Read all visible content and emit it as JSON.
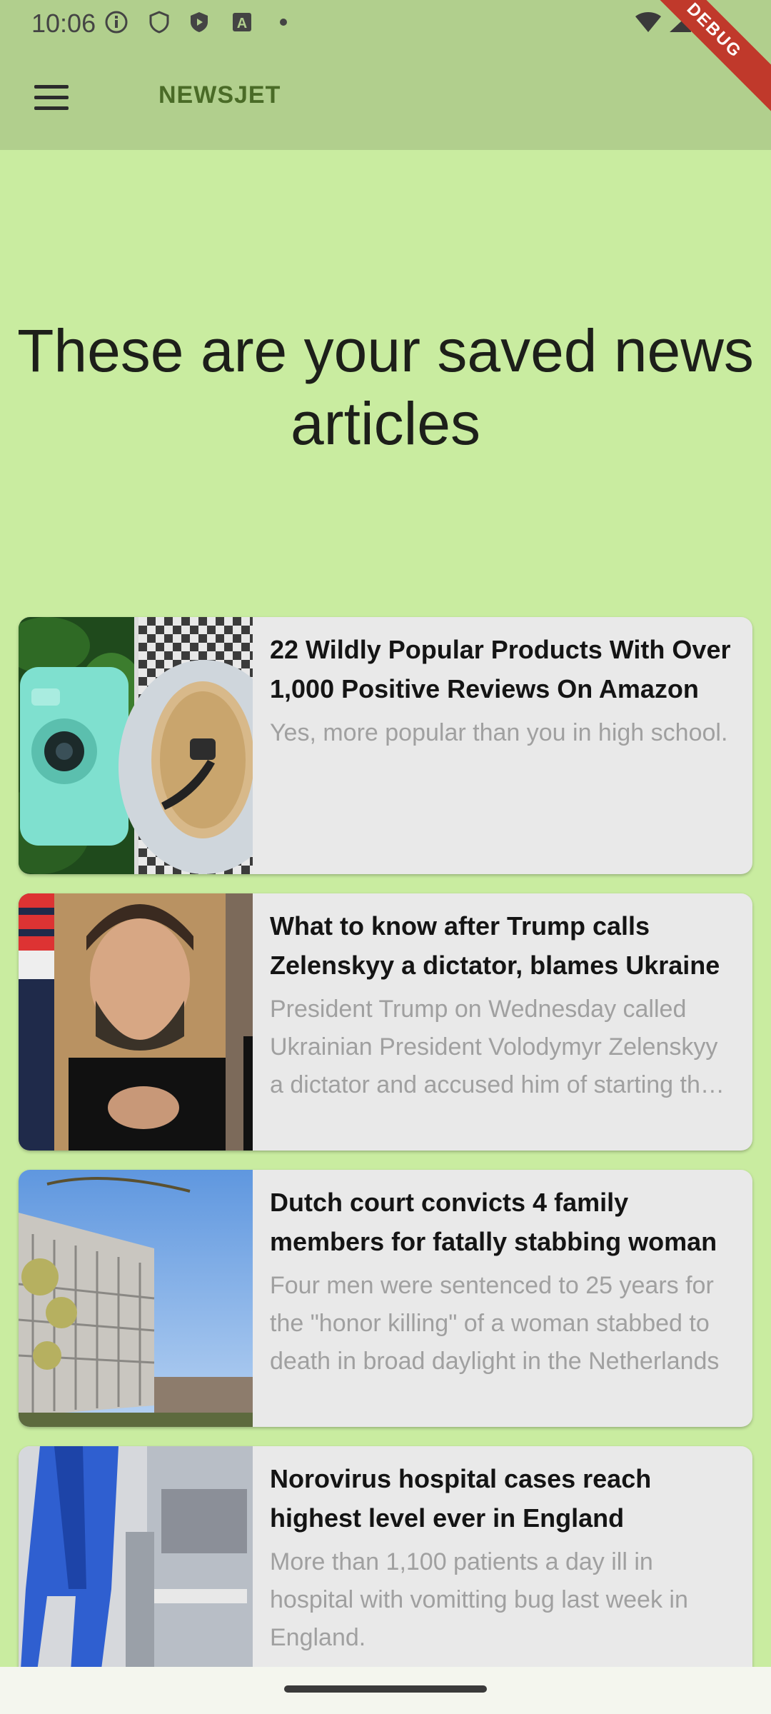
{
  "status_bar": {
    "time": "10:06",
    "icons": [
      "info-icon",
      "shield-icon",
      "play-shield-icon",
      "a-icon",
      "dot-icon",
      "wifi-icon",
      "signal-icon",
      "battery-icon"
    ]
  },
  "app_bar": {
    "title": "NEWSJET",
    "menu_icon": "hamburger-icon"
  },
  "debug_label": "DEBUG",
  "hero": {
    "heading": "These are your saved news articles"
  },
  "articles": [
    {
      "title": "22 Wildly Popular Products With Over 1,000 Positive Reviews On Amazon",
      "description": "Yes, more popular than you in high school.",
      "image": "camera-and-oats-thumbnail"
    },
    {
      "title": "What to know after Trump calls Zelenskyy a dictator, blames Ukraine",
      "description": "President Trump on Wednesday called Ukrainian President Volodymyr Zelenskyy a dictator and accused him of starting the war",
      "image": "zelenskyy-portrait-thumbnail"
    },
    {
      "title": "Dutch court convicts 4 family members for fatally stabbing woman",
      "description": "Four men were sentenced to 25 years for the \"honor killing\" of a woman stabbed to death in broad daylight in the Netherlands",
      "image": "building-and-sky-thumbnail"
    },
    {
      "title": "Norovirus hospital cases reach highest level ever in England",
      "description": "More than 1,100 patients a day ill in hospital with vomitting bug last week in England.",
      "image": "hospital-corridor-thumbnail"
    }
  ],
  "colors": {
    "background": "#c9eca0",
    "app_bar": "#b1cf8d",
    "card": "#e9e9e9",
    "title_accent": "#4a6b27"
  }
}
